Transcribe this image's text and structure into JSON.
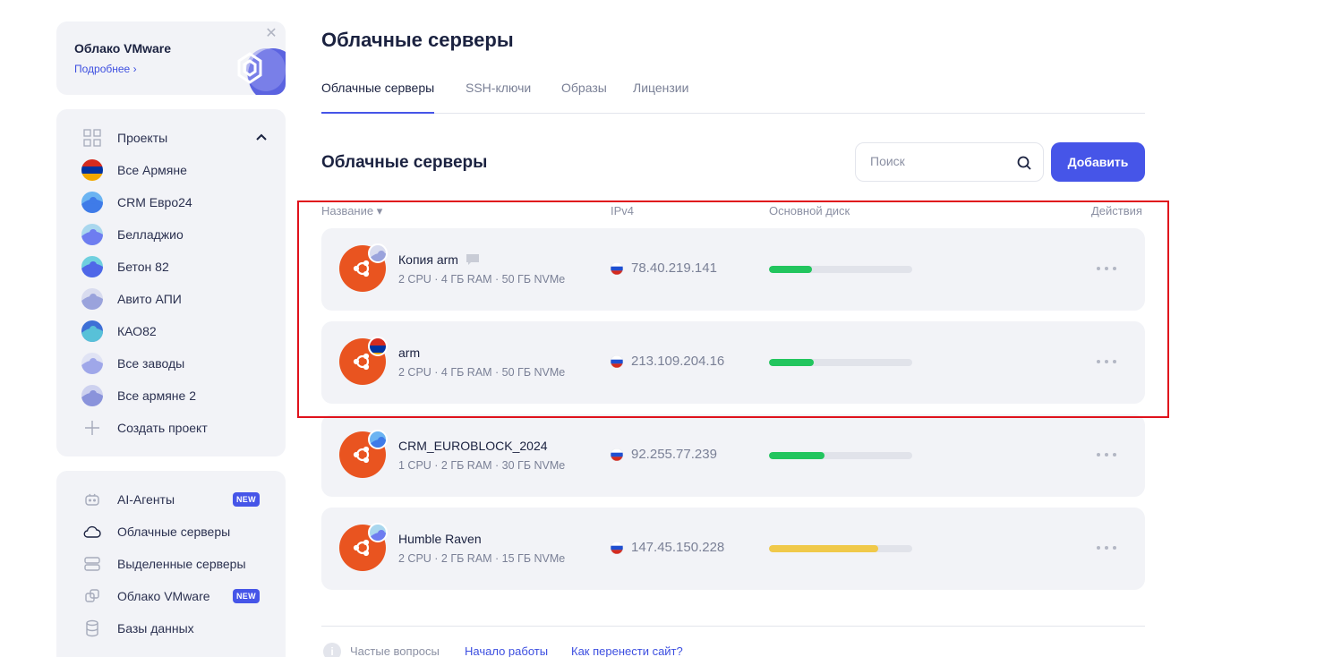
{
  "promo": {
    "title": "Облако VMware",
    "link": "Подробнее ›",
    "close_icon": "close-icon"
  },
  "projects": {
    "header": "Проекты",
    "items": [
      {
        "label": "Все Армяне",
        "colors": [
          "#d52b1e",
          "#0033a0",
          "#f2a800"
        ]
      },
      {
        "label": "CRM Евро24",
        "colors": [
          "#3f7be8",
          "#6bb4f2"
        ]
      },
      {
        "label": "Белладжио",
        "colors": [
          "#6e7df0",
          "#a9d7ee"
        ]
      },
      {
        "label": "Бетон 82",
        "colors": [
          "#4f67e8",
          "#6fd0df"
        ]
      },
      {
        "label": "Авито АПИ",
        "colors": [
          "#9aa3dc",
          "#d9dcef"
        ]
      },
      {
        "label": "КАО82",
        "colors": [
          "#58c1d8",
          "#3d6fd6"
        ]
      },
      {
        "label": "Все заводы",
        "colors": [
          "#9fa7e9",
          "#e0e3f4"
        ]
      },
      {
        "label": "Все армяне 2",
        "colors": [
          "#8a93db",
          "#cdd1ef"
        ]
      },
      {
        "label": "Создать проект"
      }
    ]
  },
  "menu": {
    "items": [
      {
        "label": "AI-Агенты",
        "badge": "NEW",
        "icon": "robot-icon"
      },
      {
        "label": "Облачные серверы",
        "icon": "cloud-icon",
        "active": true
      },
      {
        "label": "Выделенные серверы",
        "icon": "server-icon"
      },
      {
        "label": "Облако VMware",
        "badge": "NEW",
        "icon": "vmware-icon"
      },
      {
        "label": "Базы данных",
        "icon": "database-icon"
      }
    ]
  },
  "page": {
    "title": "Облачные серверы"
  },
  "tabs": [
    "Облачные серверы",
    "SSH-ключи",
    "Образы",
    "Лицензии"
  ],
  "section": {
    "title": "Облачные серверы"
  },
  "search": {
    "placeholder": "Поиск"
  },
  "add_button": "Добавить",
  "columns": {
    "name": "Название ▾",
    "ipv4": "IPv4",
    "disk": "Основной диск",
    "actions": "Действия"
  },
  "servers": [
    {
      "name": "Копия arm",
      "spec": "2 CPU · 4 ГБ RAM · 50 ГБ NVMe",
      "ip": "78.40.219.141",
      "disk_usage": 0.3,
      "disk_color": "#22c55e",
      "has_comment": true,
      "project": "Авито АПИ"
    },
    {
      "name": "arm",
      "spec": "2 CPU · 4 ГБ RAM · 50 ГБ NVMe",
      "ip": "213.109.204.16",
      "disk_usage": 0.31,
      "disk_color": "#22c55e",
      "has_comment": false,
      "project": "Все Армяне"
    },
    {
      "name": "CRM_EUROBLOCK_2024",
      "spec": "1 CPU · 2 ГБ RAM · 30 ГБ NVMe",
      "ip": "92.255.77.239",
      "disk_usage": 0.39,
      "disk_color": "#22c55e",
      "has_comment": false,
      "project": "CRM Евро24"
    },
    {
      "name": "Humble Raven",
      "spec": "2 CPU · 2 ГБ RAM · 15 ГБ NVMe",
      "ip": "147.45.150.228",
      "disk_usage": 0.76,
      "disk_color": "#f0c94a",
      "has_comment": false,
      "project": "Белладжио"
    }
  ],
  "footer": {
    "faq": "Частые вопросы",
    "links": [
      "Начало работы",
      "Как перенести сайт?"
    ]
  },
  "colors": {
    "accent": "#4655e8",
    "ubuntu": "#e95420",
    "highlight": "#e0121c"
  }
}
